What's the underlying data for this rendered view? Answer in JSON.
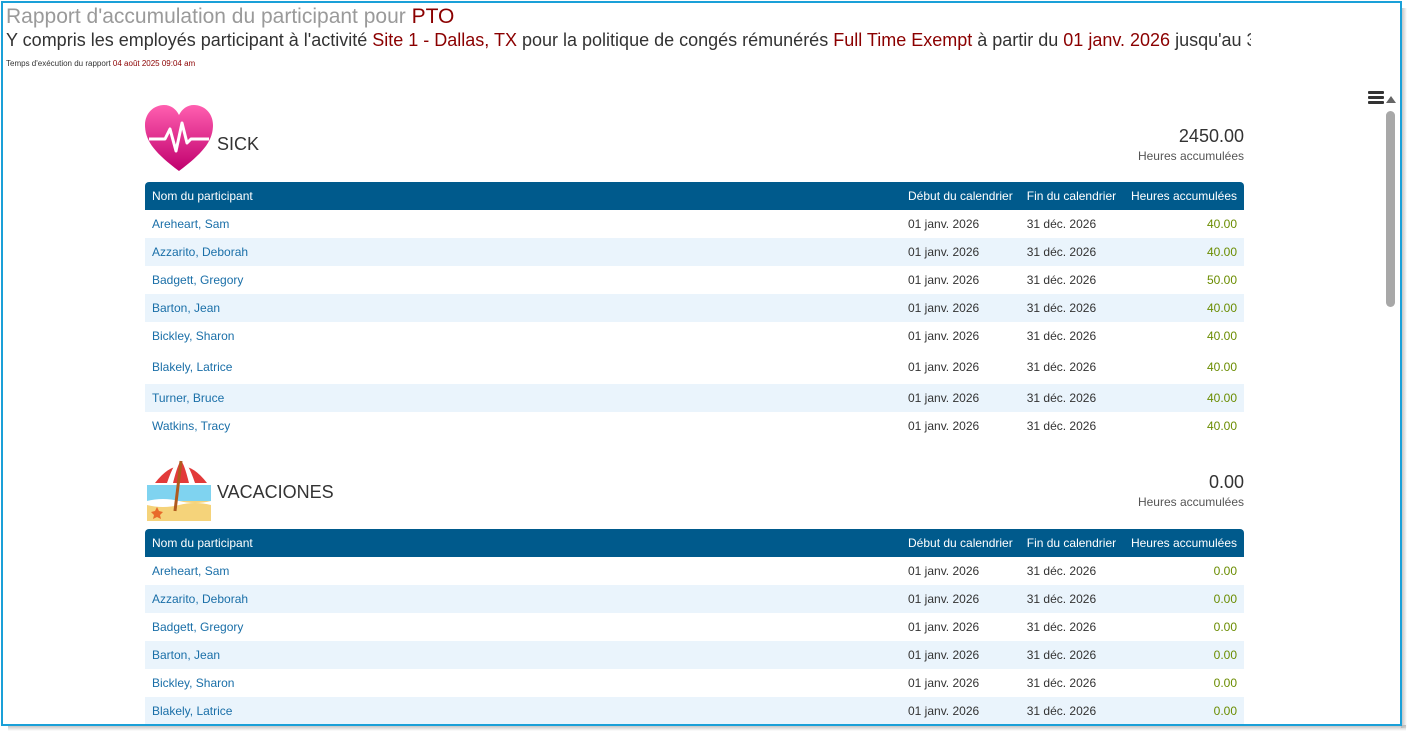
{
  "header": {
    "title_prefix": "Rapport d'accumulation du participant pour ",
    "title_policy": "PTO",
    "sub_a": "Y compris les employés participant à l'activité ",
    "sub_site": "Site 1 - Dallas, TX ",
    "sub_b": " pour la politique de congés rémunérés ",
    "sub_policy": "Full Time Exempt ",
    "sub_c": " à partir du ",
    "sub_from": "01 janv. 2026",
    "sub_d": " jusqu'au 3",
    "exec_label": "Temps d'exécution du rapport ",
    "exec_value": "04 août 2025 09:04 am"
  },
  "columns": {
    "name": "Nom du participant",
    "start": "Début du calendrier",
    "end": "Fin du calendrier",
    "hours": "Heures accumulées"
  },
  "sick": {
    "name": "SICK",
    "total": "2450.00",
    "total_label": "Heures accumulées",
    "icon": "heart-pulse-icon",
    "rows": [
      {
        "name": "Areheart, Sam",
        "start": "01 janv. 2026",
        "end": "31 déc. 2026",
        "hours": "40.00"
      },
      {
        "name": "Azzarito, Deborah",
        "start": "01 janv. 2026",
        "end": "31 déc. 2026",
        "hours": "40.00"
      },
      {
        "name": "Badgett, Gregory",
        "start": "01 janv. 2026",
        "end": "31 déc. 2026",
        "hours": "50.00"
      },
      {
        "name": "Barton, Jean",
        "start": "01 janv. 2026",
        "end": "31 déc. 2026",
        "hours": "40.00"
      },
      {
        "name": "Bickley, Sharon",
        "start": "01 janv. 2026",
        "end": "31 déc. 2026",
        "hours": "40.00"
      },
      {
        "name": "Blakely, Latrice",
        "start": "01 janv. 2026",
        "end": "31 déc. 2026",
        "hours": "40.00"
      },
      {
        "name": "Turner, Bruce",
        "start": "01 janv. 2026",
        "end": "31 déc. 2026",
        "hours": "40.00"
      },
      {
        "name": "Watkins, Tracy",
        "start": "01 janv. 2026",
        "end": "31 déc. 2026",
        "hours": "40.00"
      }
    ]
  },
  "vacaciones": {
    "name": "VACACIONES",
    "total": "0.00",
    "total_label": "Heures accumulées",
    "icon": "beach-umbrella-icon",
    "rows": [
      {
        "name": "Areheart, Sam",
        "start": "01 janv. 2026",
        "end": "31 déc. 2026",
        "hours": "0.00"
      },
      {
        "name": "Azzarito, Deborah",
        "start": "01 janv. 2026",
        "end": "31 déc. 2026",
        "hours": "0.00"
      },
      {
        "name": "Badgett, Gregory",
        "start": "01 janv. 2026",
        "end": "31 déc. 2026",
        "hours": "0.00"
      },
      {
        "name": "Barton, Jean",
        "start": "01 janv. 2026",
        "end": "31 déc. 2026",
        "hours": "0.00"
      },
      {
        "name": "Bickley, Sharon",
        "start": "01 janv. 2026",
        "end": "31 déc. 2026",
        "hours": "0.00"
      },
      {
        "name": "Blakely, Latrice",
        "start": "01 janv. 2026",
        "end": "31 déc. 2026",
        "hours": "0.00"
      }
    ]
  }
}
